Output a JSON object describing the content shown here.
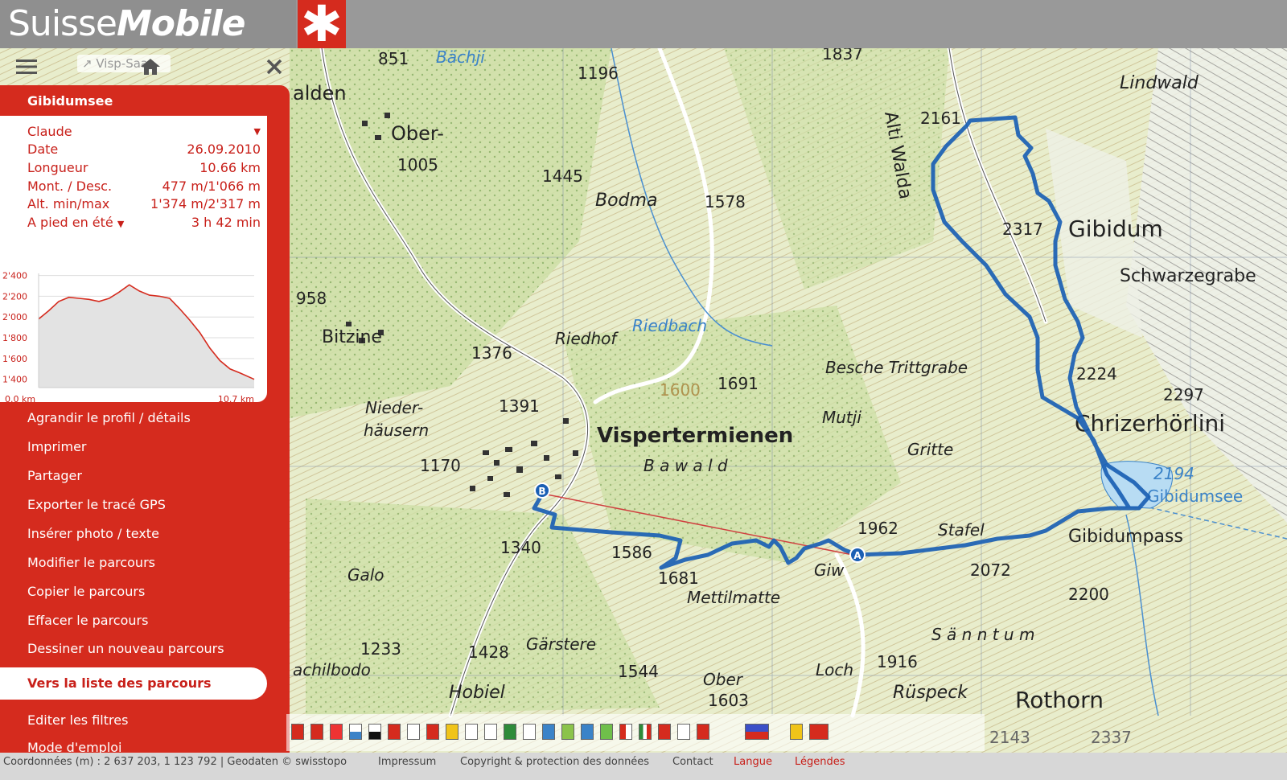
{
  "header": {
    "brand_first": "Suisse",
    "brand_second": "Mobile",
    "cross": "✱"
  },
  "toolbar": {
    "search_placeholder": "Visp-Saa",
    "menu_icon": "hamburger-icon",
    "home_icon": "home-icon",
    "close_icon": "close-icon"
  },
  "tour": {
    "title": "Gibidumsee",
    "user": "Claude",
    "details": [
      {
        "label": "Date",
        "value": "26.09.2010"
      },
      {
        "label": "Longueur",
        "value": "10.66 km"
      },
      {
        "label": "Mont. / Desc.",
        "value": "477 m/1'066 m"
      },
      {
        "label": "Alt. min/max",
        "value": "1'374 m/2'317 m"
      }
    ],
    "mode": {
      "label": "A pied en été",
      "value": "3 h 42 min"
    }
  },
  "profile_chart": {
    "chart_data": {
      "type": "area",
      "x": [
        0,
        0.5,
        1.0,
        1.5,
        2.0,
        2.5,
        3.0,
        3.5,
        4.0,
        4.5,
        5.0,
        5.5,
        6.0,
        6.5,
        7.0,
        7.5,
        8.0,
        8.5,
        9.0,
        9.5,
        10.0,
        10.7
      ],
      "y": [
        1980,
        2060,
        2150,
        2190,
        2180,
        2170,
        2150,
        2180,
        2240,
        2310,
        2250,
        2210,
        2200,
        2180,
        2080,
        1970,
        1850,
        1700,
        1580,
        1500,
        1460,
        1400
      ],
      "y_ticks": [
        "2'400",
        "2'200",
        "2'000",
        "1'800",
        "1'600",
        "1'400"
      ],
      "y_tick_values": [
        2400,
        2200,
        2000,
        1800,
        1600,
        1400
      ],
      "x_start_label": "0.0 km",
      "x_end_label": "10.7 km",
      "ylim": [
        1320,
        2420
      ],
      "xlim": [
        0,
        10.7
      ],
      "grid": true
    }
  },
  "menu": [
    "Agrandir le profil / détails",
    "Imprimer",
    "Partager",
    "Exporter le tracé GPS",
    "Insérer photo / texte",
    "Modifier le parcours",
    "Copier le parcours",
    "Effacer le parcours",
    "Dessiner un nouveau parcours"
  ],
  "list_button": "Vers la liste des parcours",
  "menu_bottom": [
    "Editer les filtres",
    "Mode d'emploi"
  ],
  "map": {
    "place_labels": [
      "Ober-",
      "1005",
      "1196",
      "1445",
      "Bodma",
      "1578",
      "958",
      "Bitzine",
      "1376",
      "Riedhof",
      "Riedbach",
      "Nieder-",
      "häusern",
      "1391",
      "1170",
      "Vispertermienen",
      "1691",
      "1600",
      "Besche Trittgrabe",
      "Mutji",
      "Gritte",
      "B a w a l d",
      "1340",
      "1586",
      "1681",
      "Galo",
      "Mettilmatte",
      "Giw",
      "1962",
      "Stafel",
      "2072",
      "1233",
      "1428",
      "Gärstere",
      "1544",
      "achilbodo",
      "Hobiel",
      "Ober",
      "1603",
      "1916",
      "Loch",
      "Rüspeck",
      "Rothorn",
      "S ä n n t u m",
      "2200",
      "Gibidumpass",
      "2194",
      "Gibidumsee",
      "Chrizerhörlini",
      "2224",
      "2297",
      "Gibidum",
      "2317",
      "Schwarzegrabe",
      "2161",
      "Lindwald",
      "Alti Walda",
      "1837",
      "851",
      "Bächji",
      "alden",
      "2143",
      "2337"
    ],
    "marker_start": "A",
    "marker_end": "B",
    "route_color": "#1a5fb4"
  },
  "footer": {
    "coords": "Coordonnées (m) : 2 637 203, 1 123 792 |  Geodaten © swisstopo",
    "links": [
      "Impressum",
      "Copyright & protection des données",
      "Contact",
      "Langue",
      "Légendes"
    ]
  }
}
